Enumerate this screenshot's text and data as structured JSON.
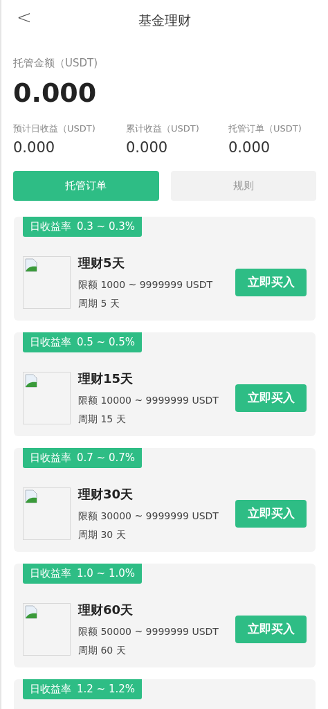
{
  "header": {
    "back": "<",
    "title": "基金理财"
  },
  "summary": {
    "label": "托管金额（USDT)",
    "value": "0.000"
  },
  "stats": [
    {
      "label": "预计日收益（USDT)",
      "value": "0.000"
    },
    {
      "label": "累计收益（USDT)",
      "value": "0.000"
    },
    {
      "label": "托管订单（USDT)",
      "value": "0.000"
    }
  ],
  "tabs": [
    {
      "label": "托管订单",
      "selected": true
    },
    {
      "label": "规则",
      "selected": false
    }
  ],
  "products": [
    {
      "rate_label": "日收益率",
      "rate": "0.3 ~ 0.3%",
      "name": "理财5天",
      "limit": "限额 1000 ~ 9999999 USDT",
      "period": "周期 5 天",
      "button": "立即买入"
    },
    {
      "rate_label": "日收益率",
      "rate": "0.5 ~ 0.5%",
      "name": "理财15天",
      "limit": "限额 10000 ~ 9999999 USDT",
      "period": "周期 15 天",
      "button": "立即买入"
    },
    {
      "rate_label": "日收益率",
      "rate": "0.7 ~ 0.7%",
      "name": "理财30天",
      "limit": "限额 30000 ~ 9999999 USDT",
      "period": "周期 30 天",
      "button": "立即买入"
    },
    {
      "rate_label": "日收益率",
      "rate": "1.0 ~ 1.0%",
      "name": "理财60天",
      "limit": "限额 50000 ~ 9999999 USDT",
      "period": "周期 60 天",
      "button": "立即买入"
    },
    {
      "rate_label": "日收益率",
      "rate": "1.2 ~ 1.2%"
    }
  ]
}
